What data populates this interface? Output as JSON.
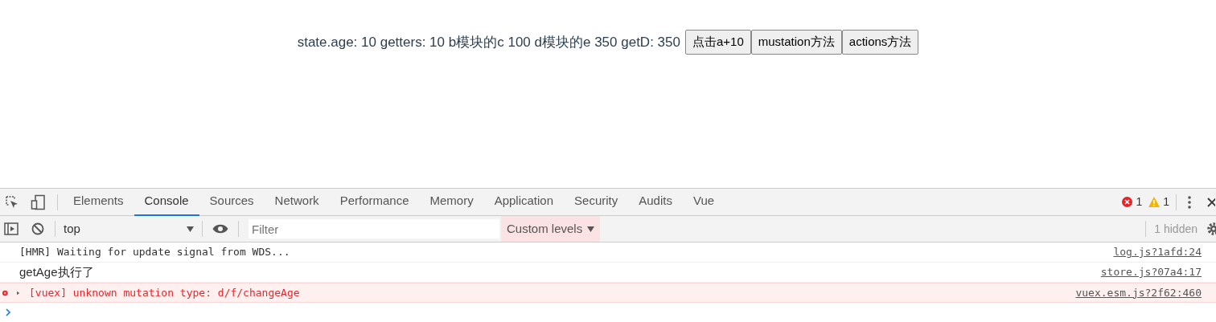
{
  "app": {
    "line": "state.age: 10 getters: 10 b模块的c 100 d模块的e 350 getD: 350",
    "buttons": [
      "点击a+10",
      "mustation方法",
      "actions方法"
    ]
  },
  "devtools": {
    "tabs": [
      {
        "label": "Elements",
        "selected": false
      },
      {
        "label": "Console",
        "selected": true
      },
      {
        "label": "Sources",
        "selected": false
      },
      {
        "label": "Network",
        "selected": false
      },
      {
        "label": "Performance",
        "selected": false
      },
      {
        "label": "Memory",
        "selected": false
      },
      {
        "label": "Application",
        "selected": false
      },
      {
        "label": "Security",
        "selected": false
      },
      {
        "label": "Audits",
        "selected": false
      },
      {
        "label": "Vue",
        "selected": false
      }
    ],
    "error_count": "1",
    "warning_count": "1",
    "context": "top",
    "filter": {
      "placeholder": "Filter"
    },
    "levels": "Custom levels",
    "hidden": "1 hidden",
    "messages": [
      {
        "kind": "log",
        "text": "[HMR] Waiting for update signal from WDS...",
        "source": "log.js?1afd:24",
        "monospace": true
      },
      {
        "kind": "log",
        "text": "getAge执行了",
        "source": "store.js?07a4:17",
        "monospace": false
      },
      {
        "kind": "error",
        "text": "[vuex] unknown mutation type: d/f/changeAge",
        "source": "vuex.esm.js?2f62:460",
        "monospace": true
      }
    ]
  }
}
